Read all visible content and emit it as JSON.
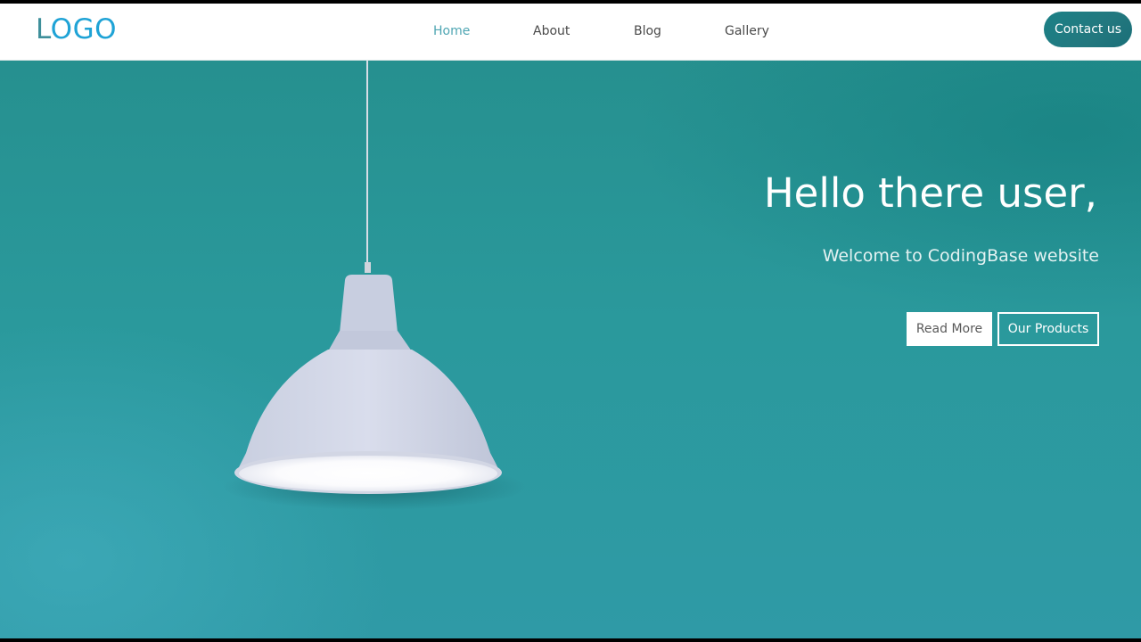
{
  "header": {
    "logo_part1": "L",
    "logo_part2": "OGO",
    "nav": [
      {
        "label": "Home",
        "active": true
      },
      {
        "label": "About",
        "active": false
      },
      {
        "label": "Blog",
        "active": false
      },
      {
        "label": "Gallery",
        "active": false
      }
    ],
    "contact_label": "Contact us"
  },
  "hero": {
    "title": "Hello there user,",
    "subtitle": "Welcome to CodingBase website",
    "read_more_label": "Read More",
    "products_label": "Our Products"
  },
  "colors": {
    "accent": "#1b8086",
    "hero_background": "#2a999c",
    "nav_active": "#4fa6b3",
    "logo_blue": "#1fa3d6"
  }
}
